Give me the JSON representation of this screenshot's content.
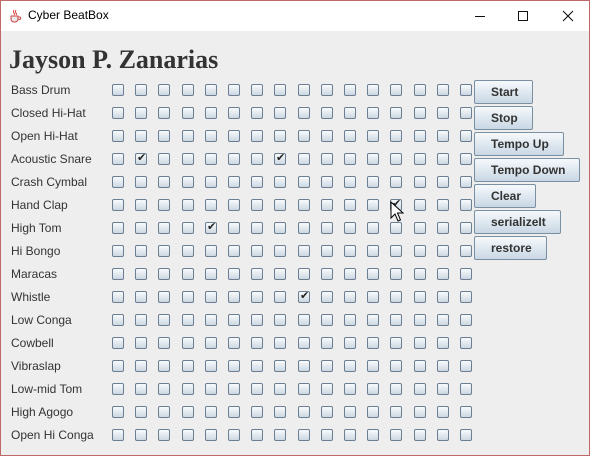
{
  "window": {
    "title": "Cyber BeatBox"
  },
  "header": {
    "title": "Jayson P. Zanarias"
  },
  "instruments": [
    {
      "name": "Bass Drum",
      "steps": [
        0,
        0,
        0,
        0,
        0,
        0,
        0,
        0,
        0,
        0,
        0,
        0,
        0,
        0,
        0,
        0
      ]
    },
    {
      "name": "Closed Hi-Hat",
      "steps": [
        0,
        0,
        0,
        0,
        0,
        0,
        0,
        0,
        0,
        0,
        0,
        0,
        0,
        0,
        0,
        0
      ]
    },
    {
      "name": "Open Hi-Hat",
      "steps": [
        0,
        0,
        0,
        0,
        0,
        0,
        0,
        0,
        0,
        0,
        0,
        0,
        0,
        0,
        0,
        0
      ]
    },
    {
      "name": "Acoustic Snare",
      "steps": [
        0,
        1,
        0,
        0,
        0,
        0,
        0,
        1,
        0,
        0,
        0,
        0,
        0,
        0,
        0,
        0
      ]
    },
    {
      "name": "Crash Cymbal",
      "steps": [
        0,
        0,
        0,
        0,
        0,
        0,
        0,
        0,
        0,
        0,
        0,
        0,
        0,
        0,
        0,
        0
      ]
    },
    {
      "name": "Hand Clap",
      "steps": [
        0,
        0,
        0,
        0,
        0,
        0,
        0,
        0,
        0,
        0,
        0,
        0,
        1,
        0,
        0,
        0
      ]
    },
    {
      "name": "High Tom",
      "steps": [
        0,
        0,
        0,
        0,
        1,
        0,
        0,
        0,
        0,
        0,
        0,
        0,
        0,
        0,
        0,
        0
      ]
    },
    {
      "name": "Hi Bongo",
      "steps": [
        0,
        0,
        0,
        0,
        0,
        0,
        0,
        0,
        0,
        0,
        0,
        0,
        0,
        0,
        0,
        0
      ]
    },
    {
      "name": "Maracas",
      "steps": [
        0,
        0,
        0,
        0,
        0,
        0,
        0,
        0,
        0,
        0,
        0,
        0,
        0,
        0,
        0,
        0
      ]
    },
    {
      "name": "Whistle",
      "steps": [
        0,
        0,
        0,
        0,
        0,
        0,
        0,
        0,
        1,
        0,
        0,
        0,
        0,
        0,
        0,
        0
      ]
    },
    {
      "name": "Low Conga",
      "steps": [
        0,
        0,
        0,
        0,
        0,
        0,
        0,
        0,
        0,
        0,
        0,
        0,
        0,
        0,
        0,
        0
      ]
    },
    {
      "name": "Cowbell",
      "steps": [
        0,
        0,
        0,
        0,
        0,
        0,
        0,
        0,
        0,
        0,
        0,
        0,
        0,
        0,
        0,
        0
      ]
    },
    {
      "name": "Vibraslap",
      "steps": [
        0,
        0,
        0,
        0,
        0,
        0,
        0,
        0,
        0,
        0,
        0,
        0,
        0,
        0,
        0,
        0
      ]
    },
    {
      "name": "Low-mid Tom",
      "steps": [
        0,
        0,
        0,
        0,
        0,
        0,
        0,
        0,
        0,
        0,
        0,
        0,
        0,
        0,
        0,
        0
      ]
    },
    {
      "name": "High Agogo",
      "steps": [
        0,
        0,
        0,
        0,
        0,
        0,
        0,
        0,
        0,
        0,
        0,
        0,
        0,
        0,
        0,
        0
      ]
    },
    {
      "name": "Open Hi Conga",
      "steps": [
        0,
        0,
        0,
        0,
        0,
        0,
        0,
        0,
        0,
        0,
        0,
        0,
        0,
        0,
        0,
        0
      ]
    }
  ],
  "buttons": {
    "start": "Start",
    "stop": "Stop",
    "tempo_up": "Tempo Up",
    "tempo_down": "Tempo Down",
    "clear": "Clear",
    "serialize": "serializeIt",
    "restore": "restore"
  },
  "icons": {
    "app": "java-cup-icon",
    "minimize": "minimize-icon",
    "maximize": "maximize-icon",
    "close": "close-icon",
    "cursor": "mouse-pointer-icon"
  }
}
